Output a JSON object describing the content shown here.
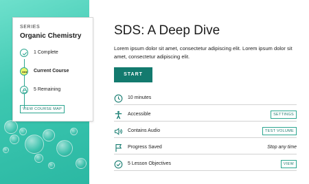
{
  "series": {
    "label": "SERIES",
    "name": "Organic Chemistry",
    "steps": [
      {
        "label": "1 Complete",
        "state": "complete",
        "icon": "check-icon"
      },
      {
        "label": "Current Course",
        "state": "current",
        "icon": "ellipsis-icon"
      },
      {
        "label": "5 Remaining",
        "state": "locked",
        "icon": "lock-icon"
      }
    ],
    "map_button": "VIEW COURSE MAP"
  },
  "course": {
    "title": "SDS: A Deep Dive",
    "description": "Lorem ipsum dolor sit amet, consectetur adipiscing elit.  Lorem ipsum dolor sit amet, consectetur adipiscing elit.",
    "start_button": "START"
  },
  "info": [
    {
      "icon": "clock-icon",
      "label": "10 minutes"
    },
    {
      "icon": "accessibility-icon",
      "label": "Accessible",
      "action": "SETTINGS"
    },
    {
      "icon": "speaker-icon",
      "label": "Contains Audio",
      "action": "TEST VOLUME"
    },
    {
      "icon": "flag-icon",
      "label": "Progress Saved",
      "note": "Stop any time"
    },
    {
      "icon": "check-circle-icon",
      "label": "5 Lesson Objectives",
      "action": "VIEW"
    }
  ],
  "colors": {
    "accent": "#137a6e",
    "teal": "#2aa58f",
    "current_step": "#e8f46a",
    "hero": "#3cc7b0"
  }
}
